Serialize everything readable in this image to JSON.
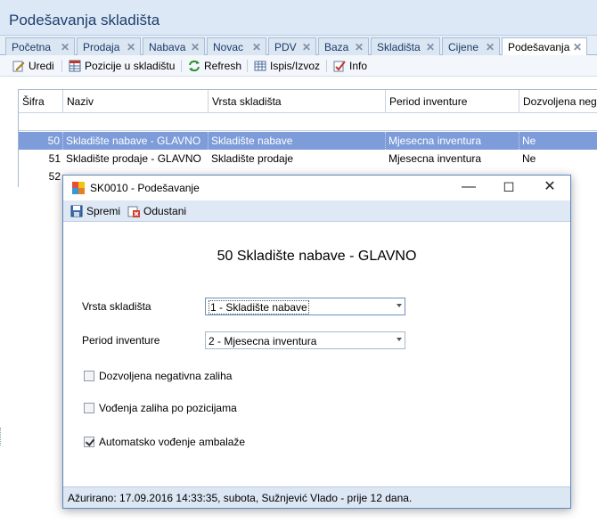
{
  "window": {
    "title": "Podešavanja skladišta"
  },
  "tabs": [
    {
      "label": "Početna"
    },
    {
      "label": "Prodaja"
    },
    {
      "label": "Nabava"
    },
    {
      "label": "Novac"
    },
    {
      "label": "PDV"
    },
    {
      "label": "Baza"
    },
    {
      "label": "Skladišta"
    },
    {
      "label": "Cijene"
    },
    {
      "label": "Podešavanja"
    }
  ],
  "toolbar": {
    "edit_label": "Uredi",
    "positions_label": "Pozicije u skladištu",
    "refresh_label": "Refresh",
    "print_label": "Ispis/Izvoz",
    "info_label": "Info"
  },
  "grid": {
    "columns": [
      "Šifra",
      "Naziv",
      "Vrsta skladišta",
      "Period inventure",
      "Dozvoljena negat"
    ],
    "rows": [
      {
        "sifra": "50",
        "naziv": "Skladište nabave - GLAVNO",
        "vrsta": "Skladište nabave",
        "period": "Mjesecna inventura",
        "dozvoljena": "Ne"
      },
      {
        "sifra": "51",
        "naziv": "Skladište prodaje - GLAVNO",
        "vrsta": "Skladište prodaje",
        "period": "Mjesecna inventura",
        "dozvoljena": "Ne"
      },
      {
        "sifra": "52",
        "naziv": "",
        "vrsta": "",
        "period": "",
        "dozvoljena": ""
      }
    ]
  },
  "dialog": {
    "title": "SK0010 - Podešavanje",
    "save_label": "Spremi",
    "cancel_label": "Odustani",
    "heading": "50 Skladište nabave - GLAVNO",
    "vrsta_label": "Vrsta skladišta",
    "vrsta_value": "1 - Skladište nabave",
    "period_label": "Period inventure",
    "period_value": "2 - Mjesecna inventura",
    "checkboxes": [
      {
        "label": "Dozvoljena negativna zaliha",
        "checked": false
      },
      {
        "label": "Vođenja zaliha po pozicijama",
        "checked": false
      },
      {
        "label": "Automatsko vođenje ambalaže",
        "checked": true
      }
    ],
    "status": "Ažurirano: 17.09.2016 14:33:35, subota, Sužnjević Vlado -  prije 12 dana."
  }
}
